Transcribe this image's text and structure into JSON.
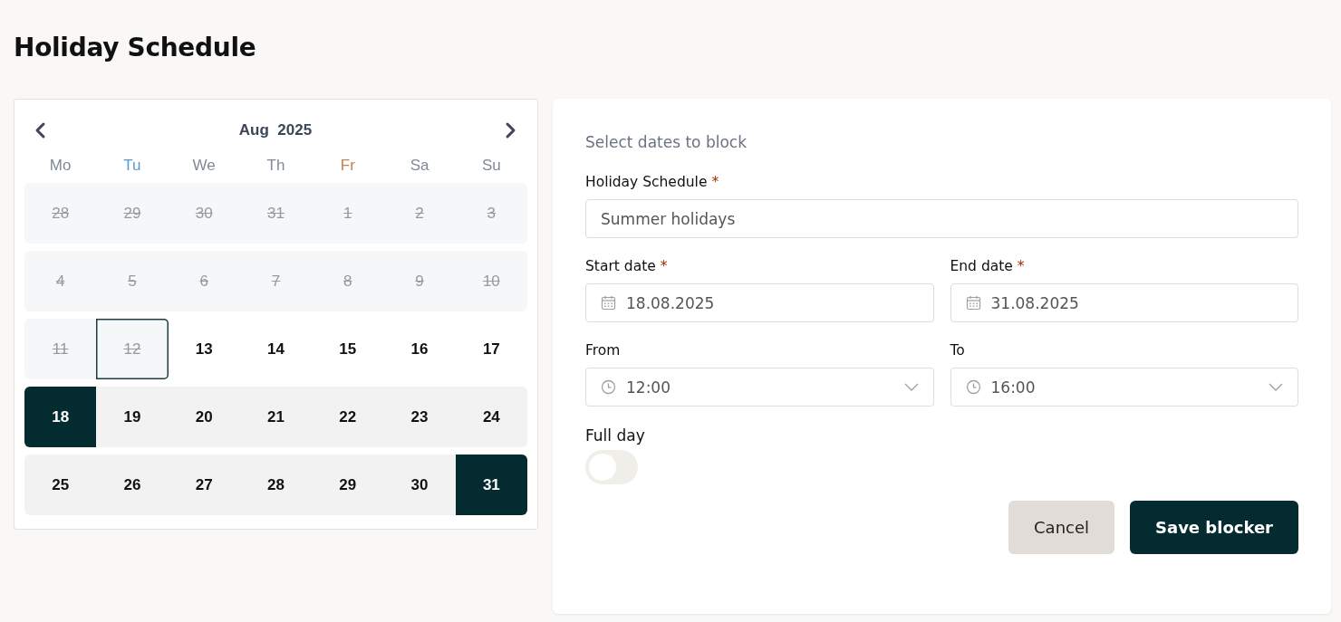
{
  "page_title": "Holiday Schedule",
  "calendar": {
    "month_label": "Aug  2025",
    "weekdays": [
      {
        "label": "Mo",
        "color": "#7f8a96"
      },
      {
        "label": "Tu",
        "color": "#5a9ad0"
      },
      {
        "label": "We",
        "color": "#7f8a96"
      },
      {
        "label": "Th",
        "color": "#7f8a96"
      },
      {
        "label": "Fr",
        "color": "#c08058"
      },
      {
        "label": "Sa",
        "color": "#7f8a96"
      },
      {
        "label": "Su",
        "color": "#7f8a96"
      }
    ],
    "weeks": [
      [
        {
          "day": "28",
          "kind": "disabled",
          "selected": false,
          "focused": false
        },
        {
          "day": "29",
          "kind": "disabled",
          "selected": false,
          "focused": false
        },
        {
          "day": "30",
          "kind": "disabled",
          "selected": false,
          "focused": false
        },
        {
          "day": "31",
          "kind": "disabled",
          "selected": false,
          "focused": false
        },
        {
          "day": "1",
          "kind": "disabled",
          "selected": false,
          "focused": false
        },
        {
          "day": "2",
          "kind": "disabled",
          "selected": false,
          "focused": false
        },
        {
          "day": "3",
          "kind": "disabled",
          "selected": false,
          "focused": false
        }
      ],
      [
        {
          "day": "4",
          "kind": "disabled",
          "selected": false,
          "focused": false
        },
        {
          "day": "5",
          "kind": "disabled",
          "selected": false,
          "focused": false
        },
        {
          "day": "6",
          "kind": "disabled",
          "selected": false,
          "focused": false
        },
        {
          "day": "7",
          "kind": "disabled",
          "selected": false,
          "focused": false
        },
        {
          "day": "8",
          "kind": "disabled",
          "selected": false,
          "focused": false
        },
        {
          "day": "9",
          "kind": "disabled",
          "selected": false,
          "focused": false
        },
        {
          "day": "10",
          "kind": "disabled",
          "selected": false,
          "focused": false
        }
      ],
      [
        {
          "day": "11",
          "kind": "disabled",
          "selected": false,
          "focused": false
        },
        {
          "day": "12",
          "kind": "disabled",
          "selected": false,
          "focused": true
        },
        {
          "day": "13",
          "kind": "available",
          "selected": false,
          "focused": false
        },
        {
          "day": "14",
          "kind": "available",
          "selected": false,
          "focused": false
        },
        {
          "day": "15",
          "kind": "available",
          "selected": false,
          "focused": false
        },
        {
          "day": "16",
          "kind": "available",
          "selected": false,
          "focused": false
        },
        {
          "day": "17",
          "kind": "available",
          "selected": false,
          "focused": false
        }
      ],
      [
        {
          "day": "18",
          "kind": "range",
          "selected": true,
          "focused": false
        },
        {
          "day": "19",
          "kind": "range",
          "selected": false,
          "focused": false
        },
        {
          "day": "20",
          "kind": "range",
          "selected": false,
          "focused": false
        },
        {
          "day": "21",
          "kind": "range",
          "selected": false,
          "focused": false
        },
        {
          "day": "22",
          "kind": "range",
          "selected": false,
          "focused": false
        },
        {
          "day": "23",
          "kind": "range",
          "selected": false,
          "focused": false
        },
        {
          "day": "24",
          "kind": "range",
          "selected": false,
          "focused": false
        }
      ],
      [
        {
          "day": "25",
          "kind": "range",
          "selected": false,
          "focused": false
        },
        {
          "day": "26",
          "kind": "range",
          "selected": false,
          "focused": false
        },
        {
          "day": "27",
          "kind": "range",
          "selected": false,
          "focused": false
        },
        {
          "day": "28",
          "kind": "range",
          "selected": false,
          "focused": false
        },
        {
          "day": "29",
          "kind": "range",
          "selected": false,
          "focused": false
        },
        {
          "day": "30",
          "kind": "range",
          "selected": false,
          "focused": false
        },
        {
          "day": "31",
          "kind": "range",
          "selected": true,
          "focused": false
        }
      ]
    ]
  },
  "form": {
    "heading": "Select dates to block",
    "name_field": {
      "label": "Holiday Schedule",
      "required_mark": "*",
      "value": "Summer holidays"
    },
    "start_date": {
      "label": "Start date",
      "required_mark": "*",
      "value": "18.08.2025"
    },
    "end_date": {
      "label": "End date",
      "required_mark": "*",
      "value": "31.08.2025"
    },
    "from_time": {
      "label": "From",
      "value": "12:00"
    },
    "to_time": {
      "label": "To",
      "value": "16:00"
    },
    "full_day": {
      "label": "Full day",
      "on": false
    },
    "buttons": [
      {
        "label": "Cancel",
        "kind": "secondary"
      },
      {
        "label": "Save blocker",
        "kind": "primary"
      }
    ]
  }
}
